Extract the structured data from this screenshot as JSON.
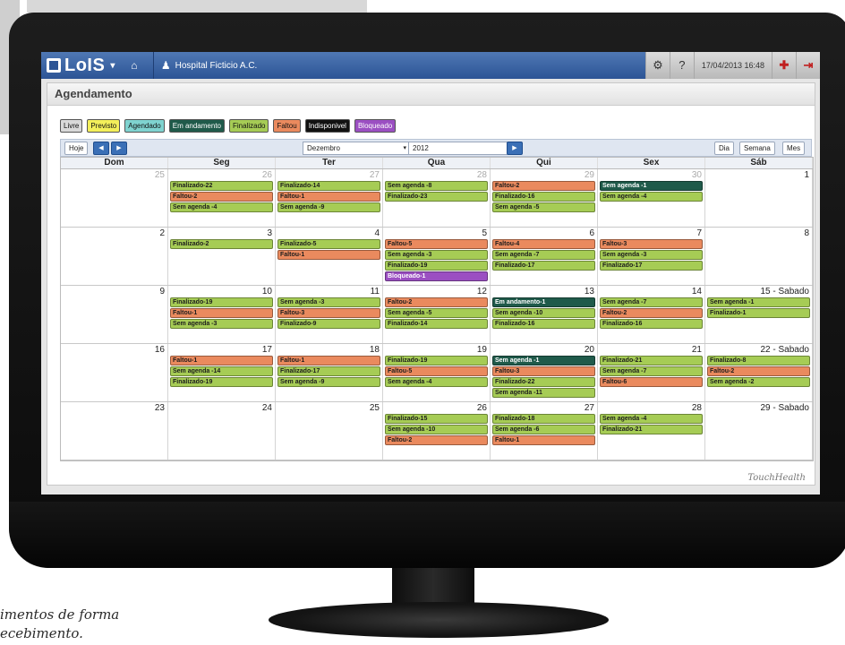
{
  "topbar": {
    "app_name": "LoIS",
    "hospital": "Hospital Ficticio A.C.",
    "datetime": "17/04/2013 16:48"
  },
  "panel_title": "Agendamento",
  "legend": [
    {
      "label": "Livre",
      "color": "#d9d9d9"
    },
    {
      "label": "Previsto",
      "color": "#f3ef5a"
    },
    {
      "label": "Agendado",
      "color": "#7fd3d0"
    },
    {
      "label": "Em andamento",
      "color": "#1f5a4a"
    },
    {
      "label": "Finalizado",
      "color": "#a6cc55"
    },
    {
      "label": "Faltou",
      "color": "#ea8a5e"
    },
    {
      "label": "Indisponivel",
      "color": "#111111"
    },
    {
      "label": "Bloqueado",
      "color": "#9b4fc2"
    }
  ],
  "toolbar": {
    "today": "Hoje",
    "month": "Dezembro",
    "year": "2012",
    "view_day": "Dia",
    "view_week": "Semana",
    "view_month": "Mes"
  },
  "weekdays": [
    "Dom",
    "Seg",
    "Ter",
    "Qua",
    "Qui",
    "Sex",
    "Sáb"
  ],
  "weeks": [
    [
      {
        "num": "25",
        "other": true,
        "events": []
      },
      {
        "num": "26",
        "other": true,
        "events": [
          [
            "fin",
            "Finalizado-22"
          ],
          [
            "fal",
            "Faltou-2"
          ],
          [
            "sem",
            "Sem agenda -4"
          ]
        ]
      },
      {
        "num": "27",
        "other": true,
        "events": [
          [
            "fin",
            "Finalizado-14"
          ],
          [
            "fal",
            "Faltou-1"
          ],
          [
            "sem",
            "Sem agenda -9"
          ]
        ]
      },
      {
        "num": "28",
        "other": true,
        "events": [
          [
            "sem",
            "Sem agenda -8"
          ],
          [
            "fin",
            "Finalizado-23"
          ]
        ]
      },
      {
        "num": "29",
        "other": true,
        "events": [
          [
            "fal",
            "Faltou-2"
          ],
          [
            "fin",
            "Finalizado-16"
          ],
          [
            "sem",
            "Sem agenda -5"
          ]
        ]
      },
      {
        "num": "30",
        "other": true,
        "events": [
          [
            "and",
            "Sem agenda -1"
          ],
          [
            "sem",
            "Sem agenda -4"
          ]
        ]
      },
      {
        "num": "1",
        "other": false,
        "events": []
      }
    ],
    [
      {
        "num": "2",
        "other": false,
        "events": []
      },
      {
        "num": "3",
        "other": false,
        "events": [
          [
            "fin",
            "Finalizado-2"
          ]
        ]
      },
      {
        "num": "4",
        "other": false,
        "events": [
          [
            "fin",
            "Finalizado-5"
          ],
          [
            "fal",
            "Faltou-1"
          ]
        ]
      },
      {
        "num": "5",
        "other": false,
        "events": [
          [
            "fal",
            "Faltou-5"
          ],
          [
            "sem",
            "Sem agenda -3"
          ],
          [
            "fin",
            "Finalizado-19"
          ],
          [
            "blo",
            "Bloqueado-1"
          ]
        ]
      },
      {
        "num": "6",
        "other": false,
        "events": [
          [
            "fal",
            "Faltou-4"
          ],
          [
            "sem",
            "Sem agenda -7"
          ],
          [
            "fin",
            "Finalizado-17"
          ]
        ]
      },
      {
        "num": "7",
        "other": false,
        "events": [
          [
            "fal",
            "Faltou-3"
          ],
          [
            "sem",
            "Sem agenda -3"
          ],
          [
            "fin",
            "Finalizado-17"
          ]
        ]
      },
      {
        "num": "8",
        "other": false,
        "events": []
      }
    ],
    [
      {
        "num": "9",
        "other": false,
        "events": []
      },
      {
        "num": "10",
        "other": false,
        "events": [
          [
            "fin",
            "Finalizado-19"
          ],
          [
            "fal",
            "Faltou-1"
          ],
          [
            "sem",
            "Sem agenda -3"
          ]
        ]
      },
      {
        "num": "11",
        "other": false,
        "events": [
          [
            "sem",
            "Sem agenda -3"
          ],
          [
            "fal",
            "Faltou-3"
          ],
          [
            "fin",
            "Finalizado-9"
          ]
        ]
      },
      {
        "num": "12",
        "other": false,
        "events": [
          [
            "fal",
            "Faltou-2"
          ],
          [
            "sem",
            "Sem agenda -5"
          ],
          [
            "fin",
            "Finalizado-14"
          ]
        ]
      },
      {
        "num": "13",
        "other": false,
        "events": [
          [
            "and",
            "Em andamento-1"
          ],
          [
            "sem",
            "Sem agenda -10"
          ],
          [
            "fin",
            "Finalizado-16"
          ]
        ]
      },
      {
        "num": "14",
        "other": false,
        "events": [
          [
            "sem",
            "Sem agenda -7"
          ],
          [
            "fal",
            "Faltou-2"
          ],
          [
            "fin",
            "Finalizado-16"
          ]
        ]
      },
      {
        "num": "15 - Sabado",
        "other": false,
        "events": [
          [
            "sem",
            "Sem agenda -1"
          ],
          [
            "fin",
            "Finalizado-1"
          ]
        ]
      }
    ],
    [
      {
        "num": "16",
        "other": false,
        "events": []
      },
      {
        "num": "17",
        "other": false,
        "events": [
          [
            "fal",
            "Faltou-1"
          ],
          [
            "sem",
            "Sem agenda -14"
          ],
          [
            "fin",
            "Finalizado-19"
          ]
        ]
      },
      {
        "num": "18",
        "other": false,
        "events": [
          [
            "fal",
            "Faltou-1"
          ],
          [
            "fin",
            "Finalizado-17"
          ],
          [
            "sem",
            "Sem agenda -9"
          ]
        ]
      },
      {
        "num": "19",
        "other": false,
        "events": [
          [
            "fin",
            "Finalizado-19"
          ],
          [
            "fal",
            "Faltou-5"
          ],
          [
            "sem",
            "Sem agenda -4"
          ]
        ]
      },
      {
        "num": "20",
        "other": false,
        "events": [
          [
            "and",
            "Sem agenda -1"
          ],
          [
            "fal",
            "Faltou-3"
          ],
          [
            "fin",
            "Finalizado-22"
          ],
          [
            "sem",
            "Sem agenda -11"
          ]
        ]
      },
      {
        "num": "21",
        "other": false,
        "events": [
          [
            "fin",
            "Finalizado-21"
          ],
          [
            "sem",
            "Sem agenda -7"
          ],
          [
            "fal",
            "Faltou-6"
          ]
        ]
      },
      {
        "num": "22 - Sabado",
        "other": false,
        "events": [
          [
            "fin",
            "Finalizado-8"
          ],
          [
            "fal",
            "Faltou-2"
          ],
          [
            "sem",
            "Sem agenda -2"
          ]
        ]
      }
    ],
    [
      {
        "num": "23",
        "other": false,
        "events": []
      },
      {
        "num": "24",
        "other": false,
        "events": []
      },
      {
        "num": "25",
        "other": false,
        "events": []
      },
      {
        "num": "26",
        "other": false,
        "events": [
          [
            "fin",
            "Finalizado-15"
          ],
          [
            "sem",
            "Sem agenda -10"
          ],
          [
            "fal",
            "Faltou-2"
          ]
        ]
      },
      {
        "num": "27",
        "other": false,
        "events": [
          [
            "fin",
            "Finalizado-18"
          ],
          [
            "sem",
            "Sem agenda -6"
          ],
          [
            "fal",
            "Faltou-1"
          ]
        ]
      },
      {
        "num": "28",
        "other": false,
        "events": [
          [
            "sem",
            "Sem agenda -4"
          ],
          [
            "fin",
            "Finalizado-21"
          ]
        ]
      },
      {
        "num": "29 - Sabado",
        "other": false,
        "events": []
      }
    ]
  ],
  "footer_brand": "TouchHealth",
  "caption_lines": [
    "imentos de forma",
    "ecebimento."
  ]
}
